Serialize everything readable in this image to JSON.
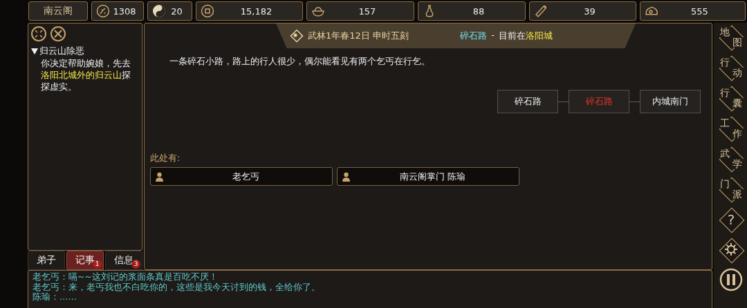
{
  "stats": [
    {
      "kind": "sect",
      "label": "南云阁"
    },
    {
      "kind": "flower",
      "value": "1308"
    },
    {
      "kind": "yinyang",
      "value": "20"
    },
    {
      "kind": "coin",
      "value": "15,182"
    },
    {
      "kind": "bowl",
      "value": "157"
    },
    {
      "kind": "gourd",
      "value": "88"
    },
    {
      "kind": "scroll",
      "value": "39"
    },
    {
      "kind": "ore",
      "value": "555"
    }
  ],
  "quest": {
    "title": "归云山除恶",
    "expanded": true,
    "text_before": "你决定帮助婉娘，先去",
    "highlight": "洛阳北城外的归云山",
    "text_after": "探探虚实。"
  },
  "tabs": [
    {
      "label": "弟子",
      "selected": false
    },
    {
      "label": "记事",
      "selected": true,
      "badge": "1"
    },
    {
      "label": "信息",
      "selected": false,
      "badge": "3"
    }
  ],
  "header": {
    "date": "武林1年春12日 申时五刻",
    "place": "碎石路",
    "separator": "-",
    "current_prefix": "目前在",
    "city": "洛阳城"
  },
  "description": "一条碎石小路，路上的行人很少，偶尔能看见有两个乞丐在行乞。",
  "map_nodes": [
    {
      "label": "碎石路",
      "selected": false
    },
    {
      "label": "碎石路",
      "selected": true
    },
    {
      "label": "内城南门",
      "selected": false
    }
  ],
  "present_label": "此处有:",
  "people": [
    {
      "name": "老乞丐"
    },
    {
      "name": "南云阁掌门 陈瑜"
    }
  ],
  "log": [
    {
      "kind": "dialogue",
      "text": "老乞丐：嗝~~这刘记的浆面条真是百吃不厌！"
    },
    {
      "kind": "dialogue",
      "text": "老乞丐：来，老丐我也不白吃你的，这些是我今天讨到的钱，全给你了。"
    },
    {
      "kind": "dialogue",
      "text": "陈瑜：……"
    }
  ],
  "sidebar": [
    {
      "kind": "text",
      "label": "地图"
    },
    {
      "kind": "text",
      "label": "行动"
    },
    {
      "kind": "text",
      "label": "行囊"
    },
    {
      "kind": "text",
      "label": "工作"
    },
    {
      "kind": "text",
      "label": "武学"
    },
    {
      "kind": "text",
      "label": "门派"
    },
    {
      "kind": "help",
      "label": "?"
    },
    {
      "kind": "settings"
    },
    {
      "kind": "pause"
    }
  ]
}
